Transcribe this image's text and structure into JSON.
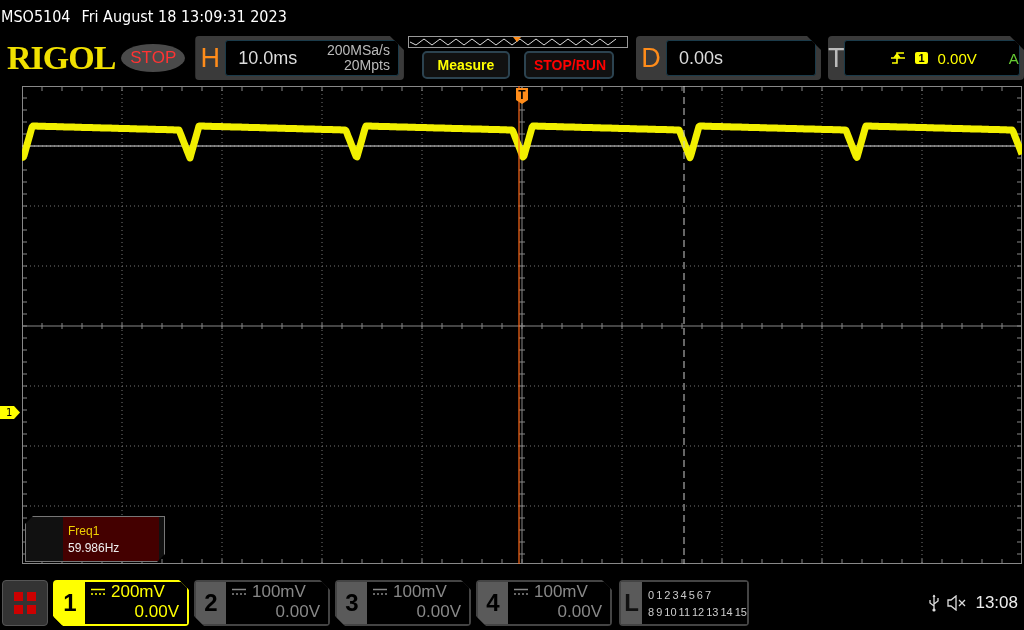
{
  "status_bar": {
    "model": "MSO5104",
    "datetime": "Fri August 18 13:09:31 2023"
  },
  "toolbar": {
    "logo": "RIGOL",
    "run_state": "STOP",
    "horizontal": {
      "label": "H",
      "timebase": "10.0ms",
      "sample_rate": "200MSa/s",
      "memory_depth": "20Mpts"
    },
    "buttons": [
      {
        "label": "Measure",
        "kind": "measure"
      },
      {
        "label": "STOP/RUN",
        "kind": "stoprun"
      }
    ],
    "delay": {
      "label": "D",
      "value": "0.00s"
    },
    "trigger": {
      "label": "T",
      "source": "1",
      "level": "0.00V",
      "mode": "A"
    }
  },
  "display": {
    "channel_marker": "1",
    "trigger_marker": "T",
    "measurement": {
      "name": "Freq1",
      "value": "59.986Hz"
    }
  },
  "channels": [
    {
      "number": "1",
      "scale": "200mV",
      "offset": "0.00V",
      "on": true
    },
    {
      "number": "2",
      "scale": "100mV",
      "offset": "0.00V",
      "on": false
    },
    {
      "number": "3",
      "scale": "100mV",
      "offset": "0.00V",
      "on": false
    },
    {
      "number": "4",
      "scale": "100mV",
      "offset": "0.00V",
      "on": false
    }
  ],
  "logic": {
    "label": "L",
    "bits": [
      "0",
      "1",
      "2",
      "3",
      "4",
      "5",
      "6",
      "7",
      "8",
      "9",
      "10",
      "11",
      "12",
      "13",
      "14",
      "15"
    ]
  },
  "clock": "13:08"
}
